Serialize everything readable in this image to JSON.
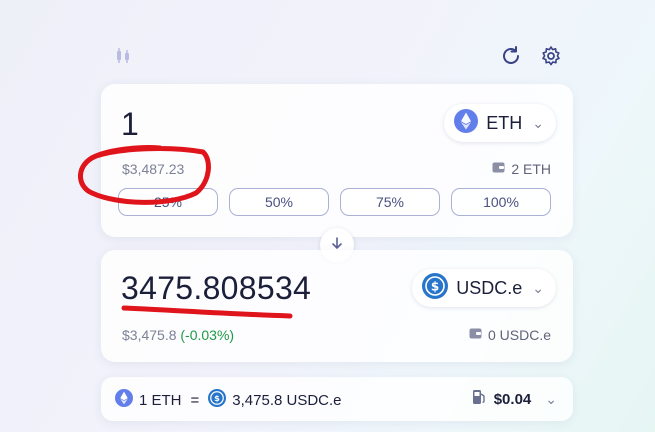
{
  "icons": {
    "chart": "candlestick-chart-icon",
    "refresh": "refresh-icon",
    "settings": "gear-icon",
    "wallet": "wallet-icon",
    "arrow": "arrow-down-icon",
    "gas": "gas-pump-icon"
  },
  "sell": {
    "amount": "1",
    "fiat_value": "$3,487.23",
    "token": "ETH",
    "balance": "2 ETH",
    "percent_buttons": [
      "25%",
      "50%",
      "75%",
      "100%"
    ]
  },
  "buy": {
    "amount": "3475.808534",
    "fiat_value": "$3,475.8",
    "price_impact": "(-0.03%)",
    "token": "USDC.e",
    "balance": "0 USDC.e"
  },
  "rate": {
    "from": "1 ETH",
    "equals": "=",
    "to": "3,475.8 USDC.e",
    "gas_fee": "$0.04"
  },
  "colors": {
    "accent": "#5a6199",
    "eth": "#627eea",
    "usdc": "#2775ca",
    "positive": "#1f9a46",
    "annotation": "#e0141b"
  }
}
